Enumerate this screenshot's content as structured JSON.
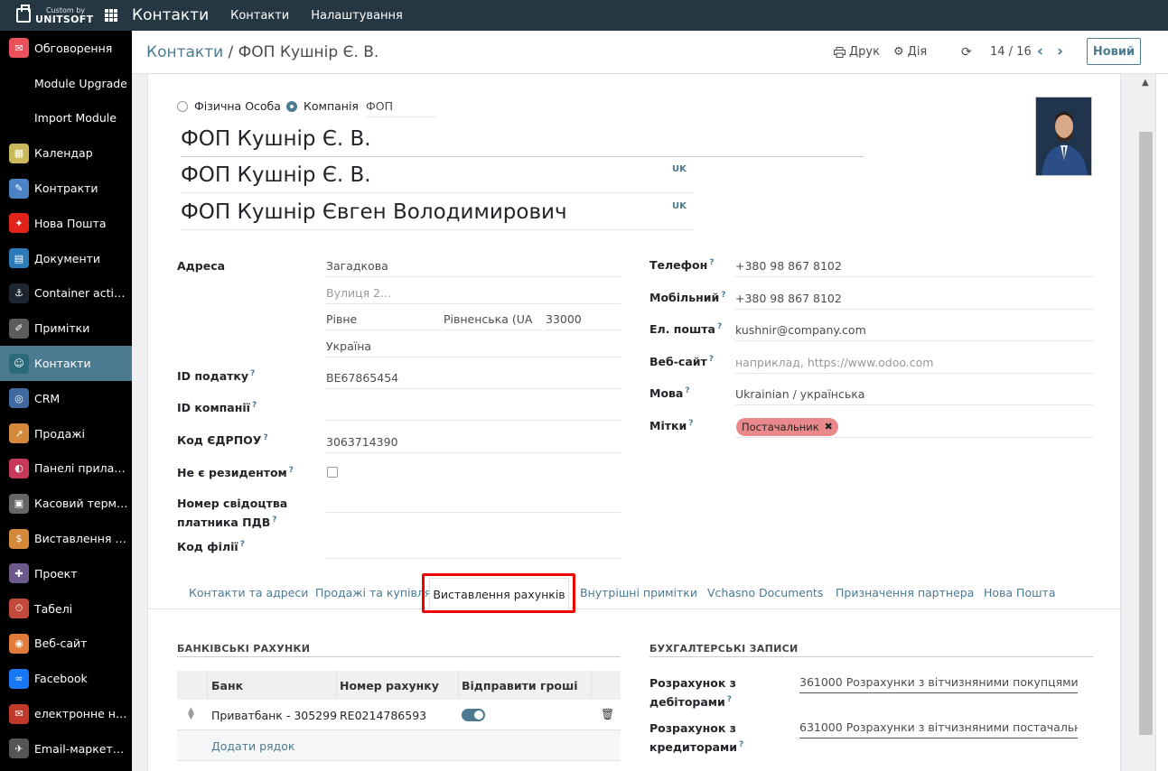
{
  "topbar": {
    "brand_small": "Custom by",
    "brand_big": "UNITSOFT",
    "app_title": "Контакти",
    "menu": [
      "Контакти",
      "Налаштування"
    ]
  },
  "sidebar": [
    {
      "label": "Обговорення",
      "icon": "chat-icon",
      "color": "#e8505b"
    },
    {
      "label": "Module Upgrade",
      "icon": "",
      "color": ""
    },
    {
      "label": "Import Module",
      "icon": "",
      "color": ""
    },
    {
      "label": "Календар",
      "icon": "calendar-icon",
      "color": "#c9b95b"
    },
    {
      "label": "Контракти",
      "icon": "contract-icon",
      "color": "#4b82c3"
    },
    {
      "label": "Нова Пошта",
      "icon": "novaposhta-icon",
      "color": "#e2231a"
    },
    {
      "label": "Документи",
      "icon": "documents-icon",
      "color": "#2b7bb9"
    },
    {
      "label": "Container actions",
      "icon": "container-icon",
      "color": "#1d2530"
    },
    {
      "label": "Примітки",
      "icon": "notes-icon",
      "color": "#5c5c5c"
    },
    {
      "label": "Контакти",
      "icon": "contacts-icon",
      "color": "#2a6a7a",
      "active": true
    },
    {
      "label": "CRM",
      "icon": "crm-icon",
      "color": "#3f6aa0"
    },
    {
      "label": "Продажі",
      "icon": "sales-icon",
      "color": "#d4893a"
    },
    {
      "label": "Панелі приладів",
      "icon": "dashboard-icon",
      "color": "#c8385b"
    },
    {
      "label": "Касовий термін…",
      "icon": "pos-icon",
      "color": "#666666"
    },
    {
      "label": "Виставлення ра…",
      "icon": "invoicing-icon",
      "color": "#d4893a"
    },
    {
      "label": "Проект",
      "icon": "project-icon",
      "color": "#6d5a8c"
    },
    {
      "label": "Табелі",
      "icon": "timesheet-icon",
      "color": "#c34a3a"
    },
    {
      "label": "Веб-сайт",
      "icon": "website-icon",
      "color": "#e07b39"
    },
    {
      "label": "Facebook",
      "icon": "facebook-icon",
      "color": "#1877f2"
    },
    {
      "label": "електронне на…",
      "icon": "email-icon",
      "color": "#c0392b"
    },
    {
      "label": "Email-маркетинг",
      "icon": "email-marketing-icon",
      "color": "#555555"
    }
  ],
  "control": {
    "breadcrumb_parent": "Контакти",
    "breadcrumb_sep": "/",
    "breadcrumb_current": "ФОП Кушнір Є. В.",
    "print": "Друк",
    "action": "Дія",
    "pager": "14 / 16",
    "new": "Новий"
  },
  "form": {
    "radio_person": "Фізична Особа",
    "radio_company": "Компанія",
    "company_type": "ФОП",
    "name": "ФОП Кушнір Є. В.",
    "name_uk": "ФОП Кушнір Є. В.",
    "full_name": "ФОП Кушнір Євген Володимирович",
    "lang_tag": "UK",
    "address_label": "Адреса",
    "street": "Загадкова",
    "street2_placeholder": "Вулиця 2...",
    "city": "Рівне",
    "state": "Рівненська (UA",
    "zip": "33000",
    "country": "Україна",
    "vat_label": "ID податку",
    "vat": "BE67865454",
    "company_id_label": "ID компанії",
    "edrpou_label": "Код ЄДРПОУ",
    "edrpou": "3063714390",
    "nonresident_label": "Не є резидентом",
    "vat_cert_label_1": "Номер свідоцтва",
    "vat_cert_label_2": "платника ПДВ",
    "branch_label": "Код філії",
    "phone_label": "Телефон",
    "phone": "+380 98 867 8102",
    "mobile_label": "Мобільний",
    "mobile": "+380 98 867 8102",
    "email_label": "Ел. пошта",
    "email": "kushnir@company.com",
    "website_label": "Веб-сайт",
    "website_placeholder": "наприклад, https://www.odoo.com",
    "language_label": "Мова",
    "language": "Ukrainian / українська",
    "tags_label": "Мітки",
    "tag": "Постачальник",
    "help_mark": "?"
  },
  "tabs": [
    "Контакти та адреси",
    "Продажі та купівля",
    "Виставлення рахунків",
    "Внутрішні примітки",
    "Vchasno Documents",
    "Призначення партнера",
    "Нова Пошта"
  ],
  "bank": {
    "title": "БАНКІВСЬКІ РАХУНКИ",
    "col_bank": "Банк",
    "col_account": "Номер рахунку",
    "col_send": "Відправити гроші",
    "row_bank": "Приватбанк - 305299",
    "row_account": "RE0214786593",
    "send_money": true,
    "add_line": "Додати рядок"
  },
  "accounting": {
    "title": "БУХГАЛТЕРСЬКІ ЗАПИСИ",
    "receivable_label_1": "Розрахунок з",
    "receivable_label_2": "дебіторами",
    "receivable": "361000 Розрахунки з вітчизняними покупцями",
    "payable_label_1": "Розрахунок з",
    "payable_label_2": "кредиторами",
    "payable": "631000 Розрахунки з вітчизняними постачальни"
  }
}
